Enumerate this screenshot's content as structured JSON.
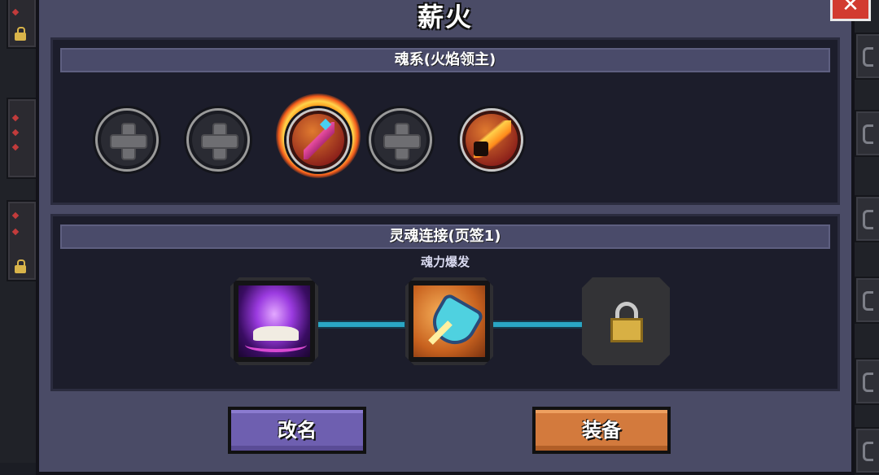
{
  "dialog": {
    "title": "薪火",
    "close_icon": "close-icon"
  },
  "soul_system": {
    "header": "魂系(火焰领主)",
    "slots": [
      {
        "state": "empty",
        "icon": "plus-icon"
      },
      {
        "state": "empty",
        "icon": "plus-icon"
      },
      {
        "state": "equipped",
        "icon": "flame-sword-soul-icon"
      },
      {
        "state": "empty",
        "icon": "plus-icon"
      },
      {
        "state": "equipped",
        "icon": "fire-dash-soul-icon"
      }
    ]
  },
  "soul_link": {
    "header": "灵魂连接(页签1)",
    "active_skill_label": "魂力爆发",
    "nodes": [
      {
        "icon": "purple-flame-book-icon",
        "state": "unlocked"
      },
      {
        "icon": "shield-blade-icon",
        "state": "unlocked"
      },
      {
        "icon": "lock-icon",
        "state": "locked"
      }
    ],
    "connector_color": "#2aa6c4"
  },
  "buttons": {
    "rename_label": "改名",
    "equip_label": "装备"
  },
  "colors": {
    "rename_button": "#6e5fb0",
    "equip_button": "#d37a3d",
    "close_button": "#d23b30"
  }
}
